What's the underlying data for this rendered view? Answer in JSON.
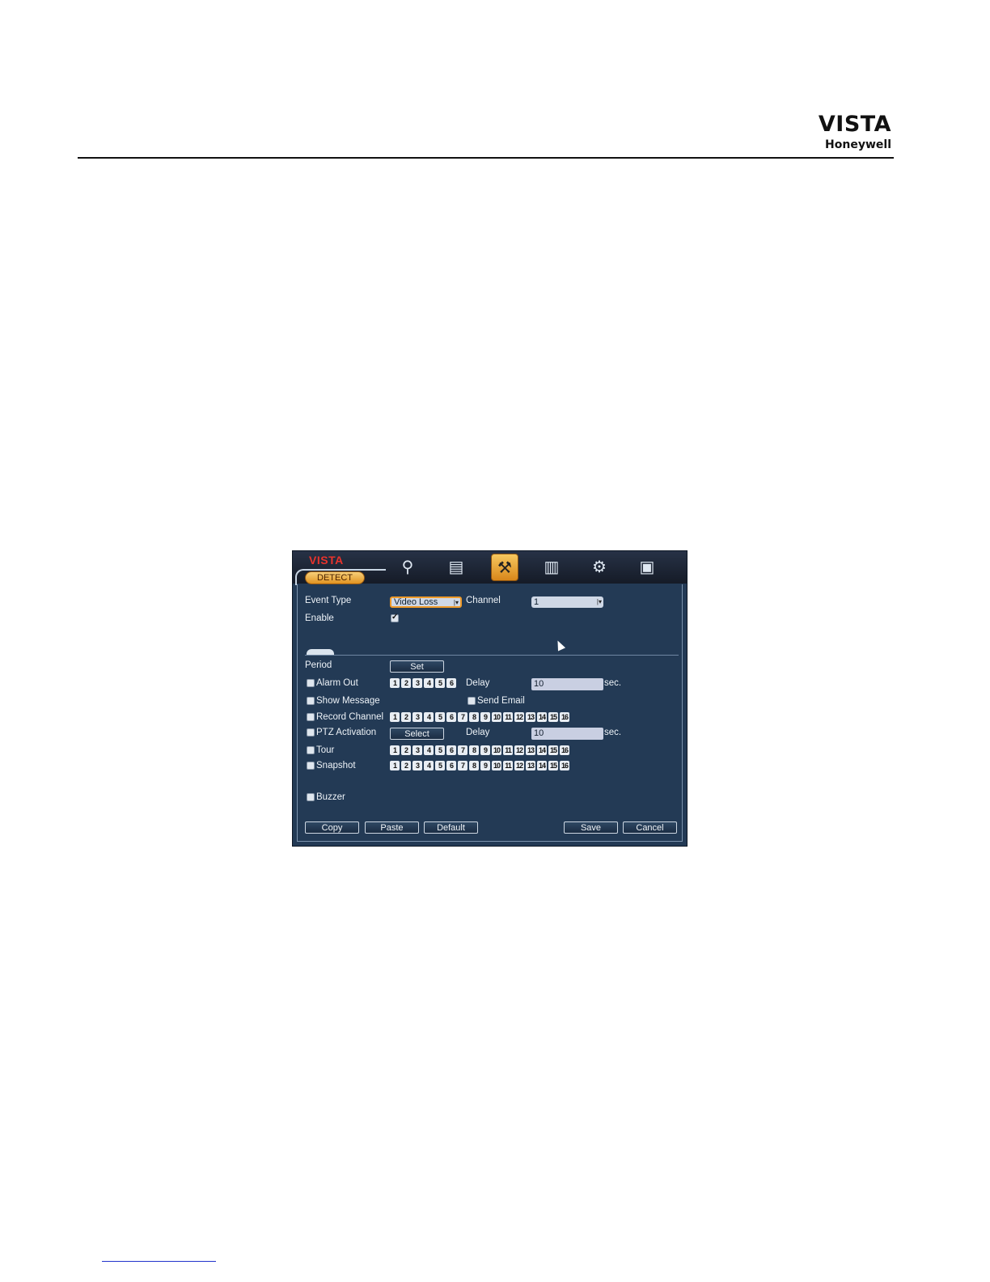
{
  "page": {
    "logo_vista": "VISTA",
    "logo_honeywell": "Honeywell"
  },
  "dvr": {
    "brand": "VISTA",
    "active_tab": "DETECT",
    "toolbar_icons": [
      "search-icon",
      "record-icon",
      "tools-icon",
      "security-icon",
      "network-icon",
      "system-icon"
    ],
    "event_type_label": "Event Type",
    "event_type_value": "Video Loss",
    "channel_label": "Channel",
    "channel_value": "1",
    "enable_label": "Enable",
    "enable_checked": true,
    "period_label": "Period",
    "set_button": "Set",
    "alarm_out_label": "Alarm Out",
    "alarm_out_numbers": [
      "1",
      "2",
      "3",
      "4",
      "5",
      "6"
    ],
    "delay_label": "Delay",
    "delay1_value": "10",
    "sec_label": "sec.",
    "show_message_label": "Show Message",
    "send_email_label": "Send Email",
    "record_channel_label": "Record Channel",
    "ptz_activation_label": "PTZ Activation",
    "select_button": "Select",
    "delay2_value": "10",
    "tour_label": "Tour",
    "snapshot_label": "Snapshot",
    "channel_numbers": [
      "1",
      "2",
      "3",
      "4",
      "5",
      "6",
      "7",
      "8",
      "9",
      "10",
      "11",
      "12",
      "13",
      "14",
      "15",
      "16"
    ],
    "buzzer_label": "Buzzer",
    "copy_button": "Copy",
    "paste_button": "Paste",
    "default_button": "Default",
    "save_button": "Save",
    "cancel_button": "Cancel"
  }
}
